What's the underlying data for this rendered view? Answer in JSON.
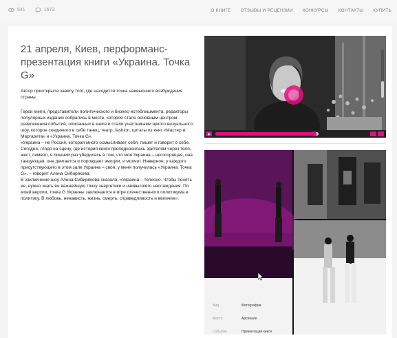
{
  "header": {
    "views": "541",
    "comments": "1673",
    "nav": [
      "О КНИГЕ",
      "ОТЗЫВЫ И РЕЦЕНЗИИ",
      "КОНКУРСЫ",
      "КОНТАКТЫ",
      "КУПИТЬ"
    ]
  },
  "article": {
    "title": "21 апреля, Киев, перформанс-презентация книги «Украина. Точка G»",
    "lead": "Автор приоткрыла завесу того, где находится точка наивысшего возбуждения страны.",
    "paragraphs": [
      "Герои книги, представители политического и бизнес-истеблишмента, редакторы популярных изданий собрались в месте, которое стало основным центром развлечения событий, описанных в книге и стали участниками яркого визуального шоу, которое соединило в себе танец, театр, fashion, цитаты из книг «Мастер и Маргарита» и «Украина. Точка G».",
      "«Украина – не Россия, которая много осмысливает себя, пишет и говорит о себе. Сегодня, глядя на сцену, где история книги преподносилась зрителям через тело, жест, символ, я лишний раз убедилась в том, что моя Украина – негосорящая, она танцующая, она двигается и порождает эмоции, и молчит. Наверное, у каждого присутствующего в этом зале Украина – своя, у меня получилась «Украина. Точка G», – говорит Алена Сибирякова.",
      "В заключение шоу Алена Сибирякова сказала: «Украина – телесно. Чтобы понять ее, нужно знать ее важнейшую точку энергетики и наивысшего наслаждения. По моей версии, точка G Украины заключается в игре отечественного политикума в политику. В любовь, ненависть, жизнь, смерть, справедливость и величие»."
    ]
  },
  "video": {
    "progress": 0.95,
    "volume": 0.35
  },
  "meta": [
    {
      "key": "Вид",
      "value": "Фотографии"
    },
    {
      "key": "Место",
      "value": "Арсенале"
    },
    {
      "key": "Событие",
      "value": "Презентация книги"
    }
  ],
  "colors": {
    "accent": "#e20f7f",
    "stage": "#9b1a8c"
  }
}
